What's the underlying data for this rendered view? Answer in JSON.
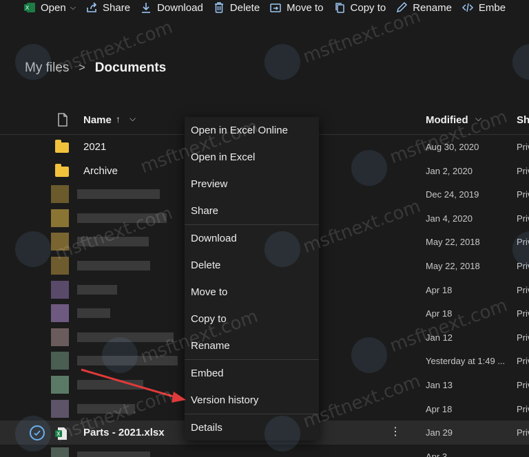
{
  "toolbar": {
    "items": [
      {
        "label": "Open",
        "icon": "excel-icon"
      },
      {
        "label": "Share",
        "icon": "share-icon"
      },
      {
        "label": "Download",
        "icon": "download-icon"
      },
      {
        "label": "Delete",
        "icon": "trash-icon"
      },
      {
        "label": "Move to",
        "icon": "move-icon"
      },
      {
        "label": "Copy to",
        "icon": "copy-icon"
      },
      {
        "label": "Rename",
        "icon": "pencil-icon"
      },
      {
        "label": "Embe",
        "icon": "embed-icon"
      }
    ]
  },
  "breadcrumb": {
    "root": "My files",
    "separator": ">",
    "current": "Documents"
  },
  "columns": {
    "name": "Name",
    "sort_indicator": "↑",
    "modified": "Modified",
    "sharing": "Sh"
  },
  "rows": [
    {
      "name": "2021",
      "type": "folder",
      "modified": "Aug 30, 2020",
      "sharing": "Priv"
    },
    {
      "name": "Archive",
      "type": "folder",
      "modified": "Jan 2, 2020",
      "sharing": "Priv"
    },
    {
      "name": "",
      "type": "blurred",
      "modified": "Dec 24, 2019",
      "sharing": "Priv"
    },
    {
      "name": "",
      "type": "blurred",
      "modified": "Jan 4, 2020",
      "sharing": "Priv"
    },
    {
      "name": "",
      "type": "blurred",
      "modified": "May 22, 2018",
      "sharing": "Priv"
    },
    {
      "name": "",
      "type": "blurred",
      "modified": "May 22, 2018",
      "sharing": "Priv"
    },
    {
      "name": "",
      "type": "blurred",
      "modified": "Apr 18",
      "sharing": "Priv"
    },
    {
      "name": "",
      "type": "blurred",
      "modified": "Apr 18",
      "sharing": "Priv"
    },
    {
      "name": "",
      "type": "blurred",
      "modified": "Jan 12",
      "sharing": "Priv"
    },
    {
      "name": "",
      "type": "blurred",
      "modified": "Yesterday at 1:49 ...",
      "sharing": "Priv"
    },
    {
      "name": "",
      "type": "blurred",
      "modified": "Jan 13",
      "sharing": "Priv"
    },
    {
      "name": "",
      "type": "blurred",
      "modified": "Apr 18",
      "sharing": "Priv"
    },
    {
      "name": "Parts - 2021.xlsx",
      "type": "excel",
      "modified": "Jan 29",
      "sharing": "Priv",
      "selected": true
    },
    {
      "name": "",
      "type": "blurred",
      "modified": "Apr 3",
      "sharing": ""
    }
  ],
  "context_menu": {
    "groups": [
      [
        "Open in Excel Online",
        "Open in Excel",
        "Preview",
        "Share"
      ],
      [
        "Download",
        "Delete",
        "Move to",
        "Copy to",
        "Rename"
      ],
      [
        "Embed",
        "Version history"
      ],
      [
        "Details"
      ]
    ]
  },
  "watermark": "msftnext.com",
  "colors": {
    "background": "#1b1b1b",
    "accent": "#6ab0f2",
    "folder": "#f2c23d",
    "arrow": "#e03a3a"
  }
}
